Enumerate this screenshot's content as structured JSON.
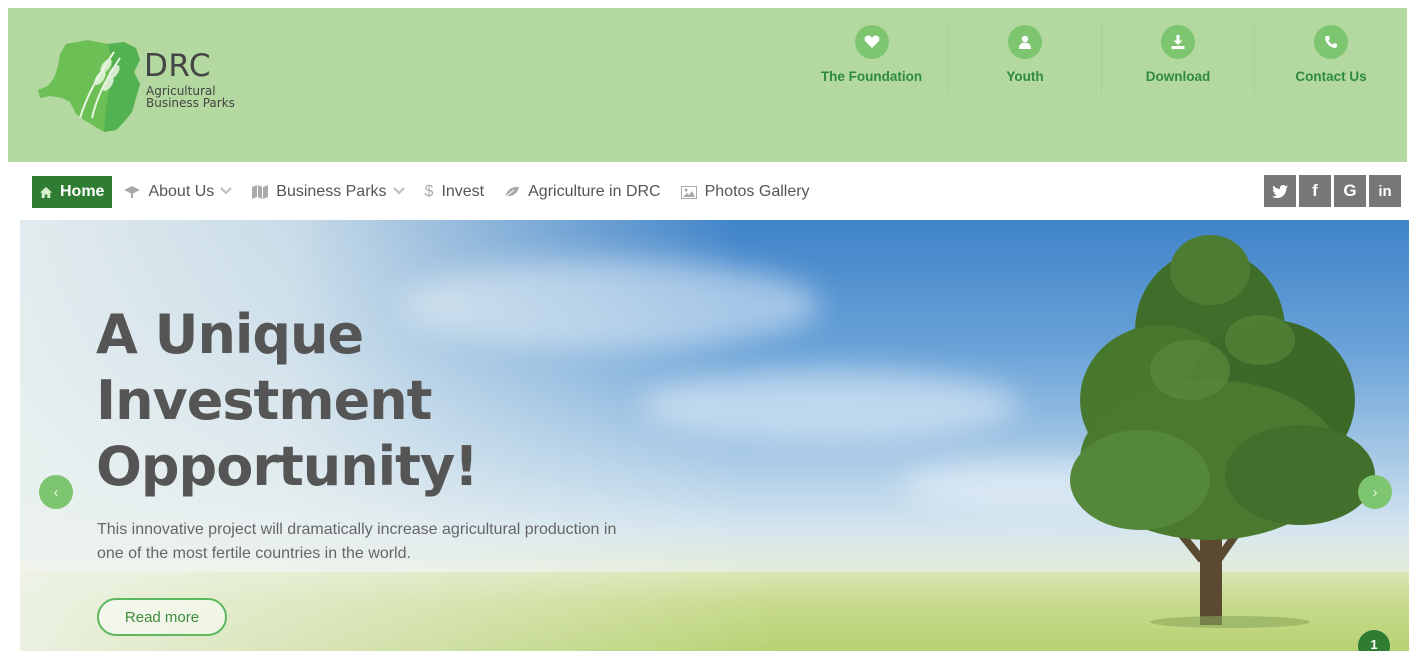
{
  "brand": {
    "name": "DRC",
    "subtitle_line1": "Agricultural",
    "subtitle_line2": "Business Parks"
  },
  "quick_links": [
    {
      "label": "The Foundation",
      "icon": "heart-icon"
    },
    {
      "label": "Youth",
      "icon": "user-icon"
    },
    {
      "label": "Download",
      "icon": "download-icon"
    },
    {
      "label": "Contact Us",
      "icon": "phone-icon"
    }
  ],
  "menu": [
    {
      "label": "Home",
      "icon": "home-icon",
      "active": true
    },
    {
      "label": "About Us",
      "icon": "graduation-cap-icon",
      "dropdown": true
    },
    {
      "label": "Business Parks",
      "icon": "map-icon",
      "dropdown": true
    },
    {
      "label": "Invest",
      "icon": "dollar-icon"
    },
    {
      "label": "Agriculture in DRC",
      "icon": "leaf-icon"
    },
    {
      "label": "Photos Gallery",
      "icon": "picture-icon"
    }
  ],
  "social": [
    {
      "name": "twitter",
      "glyph": "t",
      "icon": "twitter-icon"
    },
    {
      "name": "facebook",
      "glyph": "f",
      "icon": "facebook-icon"
    },
    {
      "name": "google",
      "glyph": "G",
      "icon": "google-icon"
    },
    {
      "name": "linkedin",
      "glyph": "in",
      "icon": "linkedin-icon"
    }
  ],
  "hero": {
    "heading_line1": "A Unique",
    "heading_line2": "Investment",
    "heading_line3": "Opportunity!",
    "text": "This innovative project will dramatically increase agricultural production in one of the most fertile countries in the world.",
    "button": "Read more",
    "prev_glyph": "‹",
    "next_glyph": "›",
    "slide_number": "1"
  },
  "colors": {
    "header_bg": "#b3d9a0",
    "accent_green": "#7dc56f",
    "active_green": "#2e7d32",
    "link_green": "#2e8b3e",
    "social_gray": "#777777"
  }
}
